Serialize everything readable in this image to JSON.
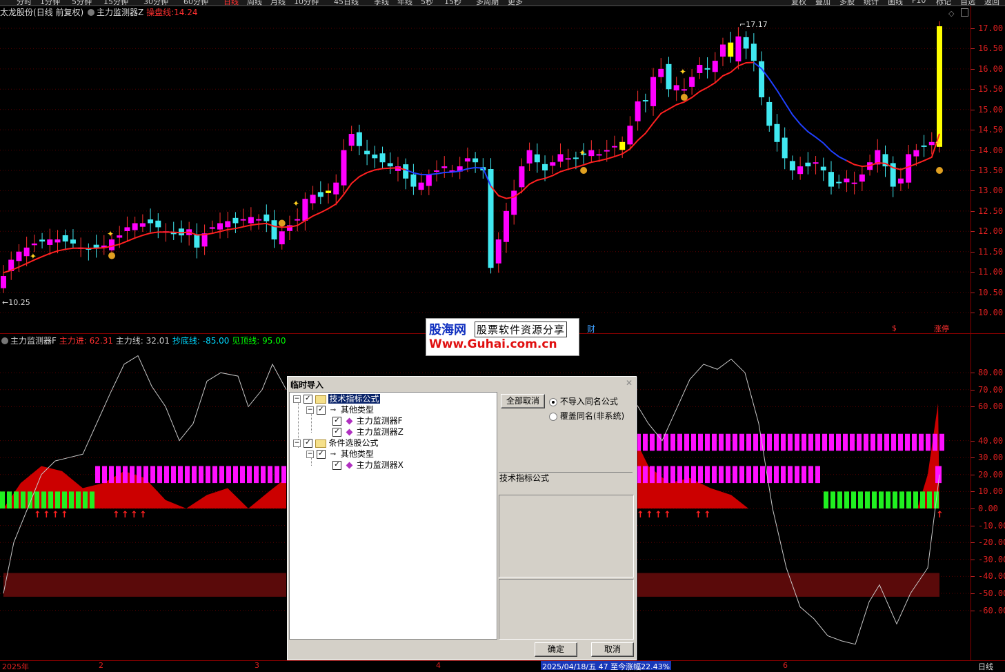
{
  "menu": [
    "分时",
    "1分钟",
    "5分钟",
    "15分钟",
    "30分钟",
    "60分钟",
    "日线",
    "周线",
    "月线",
    "10分钟",
    "45日线",
    "季线",
    "年线",
    "5秒",
    "15秒",
    "多周期",
    "更多"
  ],
  "menu_right": [
    "复权",
    "叠加",
    "多股",
    "统计",
    "画线",
    "F10",
    "标记",
    "自选",
    "返回"
  ],
  "main_chart": {
    "stock_name": "太龙股份",
    "period": "(日线 前复权)",
    "indicator_name": "主力监测器Z",
    "line_label": "操盘线:",
    "line_value": "14.24",
    "high_label": "17.17",
    "low_label": "10.25",
    "y_labels": [
      "17.00",
      "16.50",
      "16.00",
      "15.50",
      "15.00",
      "14.50",
      "14.00",
      "13.50",
      "13.00",
      "12.50",
      "12.00",
      "11.50",
      "11.00",
      "10.50",
      "10.00"
    ],
    "bottom_marks": {
      "cai": "财",
      "dollar": "$",
      "zhangting": "涨停"
    }
  },
  "sub_chart": {
    "indicator_name": "主力监测器F",
    "items": [
      {
        "label": "主力进:",
        "value": "62.31",
        "color": "#ff3030"
      },
      {
        "label": "主力线:",
        "value": "32.01",
        "color": "#cccccc"
      },
      {
        "label": "抄底线:",
        "value": "-85.00",
        "color": "#00d8ff"
      },
      {
        "label": "见顶线:",
        "value": "95.00",
        "color": "#00ff00"
      }
    ],
    "y_labels": [
      "80.00",
      "70.00",
      "60.00",
      "40.00",
      "30.00",
      "20.00",
      "10.00",
      "0.00",
      "-10.00",
      "-20.00",
      "-30.00",
      "-40.00",
      "-50.00",
      "-60.00"
    ]
  },
  "watermark": {
    "brand": "股海网",
    "slogan": "股票软件资源分享",
    "url": "Www.Guhai.com.cn"
  },
  "dialog": {
    "title": "临时导入",
    "tree": [
      {
        "label": "技术指标公式",
        "level": 0,
        "type": "folder",
        "selected": true
      },
      {
        "label": "其他类型",
        "level": 1,
        "type": "key"
      },
      {
        "label": "主力监测器F",
        "level": 2,
        "type": "gem"
      },
      {
        "label": "主力监测器Z",
        "level": 2,
        "type": "gem"
      },
      {
        "label": "条件选股公式",
        "level": 0,
        "type": "folder"
      },
      {
        "label": "其他类型",
        "level": 1,
        "type": "key"
      },
      {
        "label": "主力监测器X",
        "level": 2,
        "type": "gem"
      }
    ],
    "deselect_all": "全部取消",
    "radio_skip": "不导入同名公式",
    "radio_overwrite": "覆盖同名(非系统)",
    "info_label": "技术指标公式",
    "ok": "确定",
    "cancel": "取消"
  },
  "timeline": {
    "labels": [
      {
        "text": "2025年"
      },
      {
        "text": "2"
      },
      {
        "text": "3"
      },
      {
        "text": "4"
      },
      {
        "text": "6"
      }
    ],
    "status": "2025/04/18/五 47 至今涨幅22.43%",
    "period_tab": "日线"
  },
  "colors": {
    "up": "#ff00ff",
    "down": "#40e8f0",
    "ma_red": "#ff2020",
    "ma_blue": "#2040ff",
    "yellow": "#ffff00"
  }
}
